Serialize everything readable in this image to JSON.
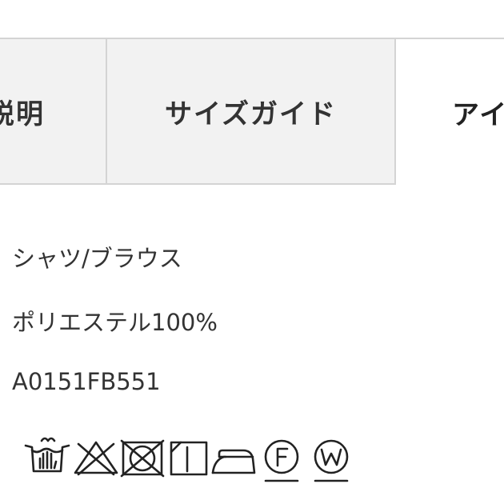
{
  "tabs": [
    {
      "label": "説明",
      "active": false
    },
    {
      "label": "サイズガイド",
      "active": false
    },
    {
      "label": "アイ",
      "active": true
    }
  ],
  "details": {
    "category": "シャツ/ブラウス",
    "material": "ポリエステル100%",
    "product_code": "A0151FB551"
  },
  "care_symbols": [
    {
      "icon": "hand-wash-icon"
    },
    {
      "icon": "do-not-bleach-icon"
    },
    {
      "icon": "do-not-tumble-dry-icon"
    },
    {
      "icon": "drip-dry-icon"
    },
    {
      "icon": "iron-low-icon"
    },
    {
      "icon": "dry-clean-f-icon",
      "letter": "F"
    },
    {
      "icon": "wet-clean-w-icon",
      "letter": "W"
    }
  ],
  "colors": {
    "tab_inactive_bg": "#f2f2f2",
    "tab_border": "#d4d4d4",
    "text": "#333333"
  }
}
